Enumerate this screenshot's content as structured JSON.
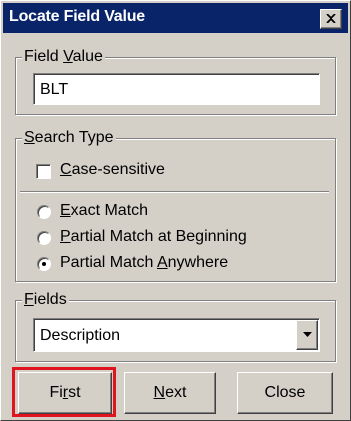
{
  "dialog": {
    "title": "Locate Field Value",
    "close_glyph": "✕"
  },
  "field_value": {
    "group_label_pre": "Field ",
    "group_label_key": "V",
    "group_label_post": "alue",
    "value": "BLT"
  },
  "search_type": {
    "group_label_key": "S",
    "group_label_post": "earch Type",
    "case_sensitive": {
      "key": "C",
      "rest": "ase-sensitive",
      "checked": false
    },
    "options": [
      {
        "key": "E",
        "pre": "",
        "rest": "xact Match",
        "selected": false
      },
      {
        "key": "P",
        "pre": "",
        "rest": "artial Match at Beginning",
        "selected": false
      },
      {
        "key": "A",
        "pre": "Partial Match ",
        "rest": "nywhere",
        "selected": true
      }
    ]
  },
  "fields": {
    "group_label_key": "F",
    "group_label_post": "ields",
    "selected": "Description"
  },
  "buttons": {
    "first": {
      "pre": "Fi",
      "key": "r",
      "post": "st"
    },
    "next": {
      "pre": "",
      "key": "N",
      "post": "ext"
    },
    "close": "Close"
  },
  "annotation": {
    "highlight_color": "#e0141e",
    "title_bar_color": "#0a246a",
    "dialog_color": "#d4d0c8"
  }
}
